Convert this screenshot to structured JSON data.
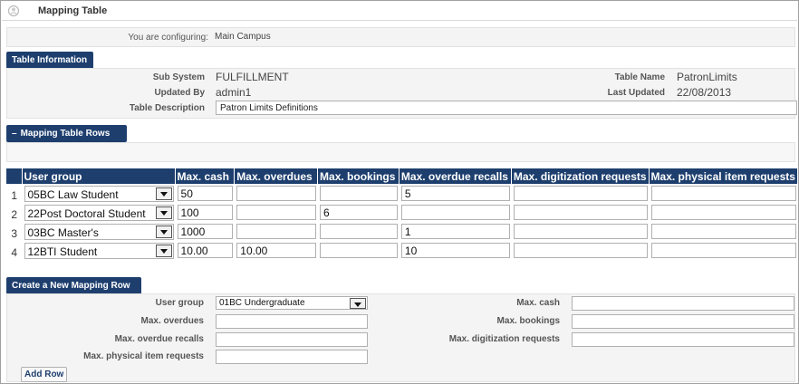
{
  "header": {
    "title": "Mapping Table"
  },
  "config": {
    "label": "You are configuring:",
    "value": "Main Campus"
  },
  "table_info": {
    "header": "Table Information",
    "sub_system_label": "Sub System",
    "sub_system": "FULFILLMENT",
    "updated_by_label": "Updated By",
    "updated_by": "admin1",
    "description_label": "Table Description",
    "description": "Patron Limits Definitions",
    "table_name_label": "Table Name",
    "table_name": "PatronLimits",
    "last_updated_label": "Last Updated",
    "last_updated": "22/08/2013"
  },
  "rows_section": {
    "header": "Mapping Table Rows",
    "collapse_glyph": "–",
    "columns": [
      "User group",
      "Max. cash",
      "Max. overdues",
      "Max. bookings",
      "Max. overdue recalls",
      "Max. digitization requests",
      "Max. physical item requests"
    ],
    "rows": [
      {
        "index": "1",
        "user_group": "05BC Law Student",
        "cash": "50",
        "overdues": "",
        "bookings": "",
        "recalls": "5",
        "digitization": "",
        "physical": ""
      },
      {
        "index": "2",
        "user_group": "22Post Doctoral Student",
        "cash": "100",
        "overdues": "",
        "bookings": "6",
        "recalls": "",
        "digitization": "",
        "physical": ""
      },
      {
        "index": "3",
        "user_group": "03BC Master's",
        "cash": "1000",
        "overdues": "",
        "bookings": "",
        "recalls": "1",
        "digitization": "",
        "physical": ""
      },
      {
        "index": "4",
        "user_group": "12BTI Student",
        "cash": "10.00",
        "overdues": "10.00",
        "bookings": "",
        "recalls": "10",
        "digitization": "",
        "physical": ""
      }
    ]
  },
  "new_row": {
    "header": "Create a New Mapping Row",
    "user_group_label": "User group",
    "user_group_value": "01BC Undergraduate",
    "overdues_label": "Max. overdues",
    "recalls_label": "Max. overdue recalls",
    "physical_label": "Max. physical item requests",
    "cash_label": "Max. cash",
    "bookings_label": "Max. bookings",
    "digitization_label": "Max. digitization requests",
    "add_row": "Add Row"
  },
  "colors": {
    "header_bg": "#1e3f6e",
    "panel_bg": "#f4f4f4"
  }
}
